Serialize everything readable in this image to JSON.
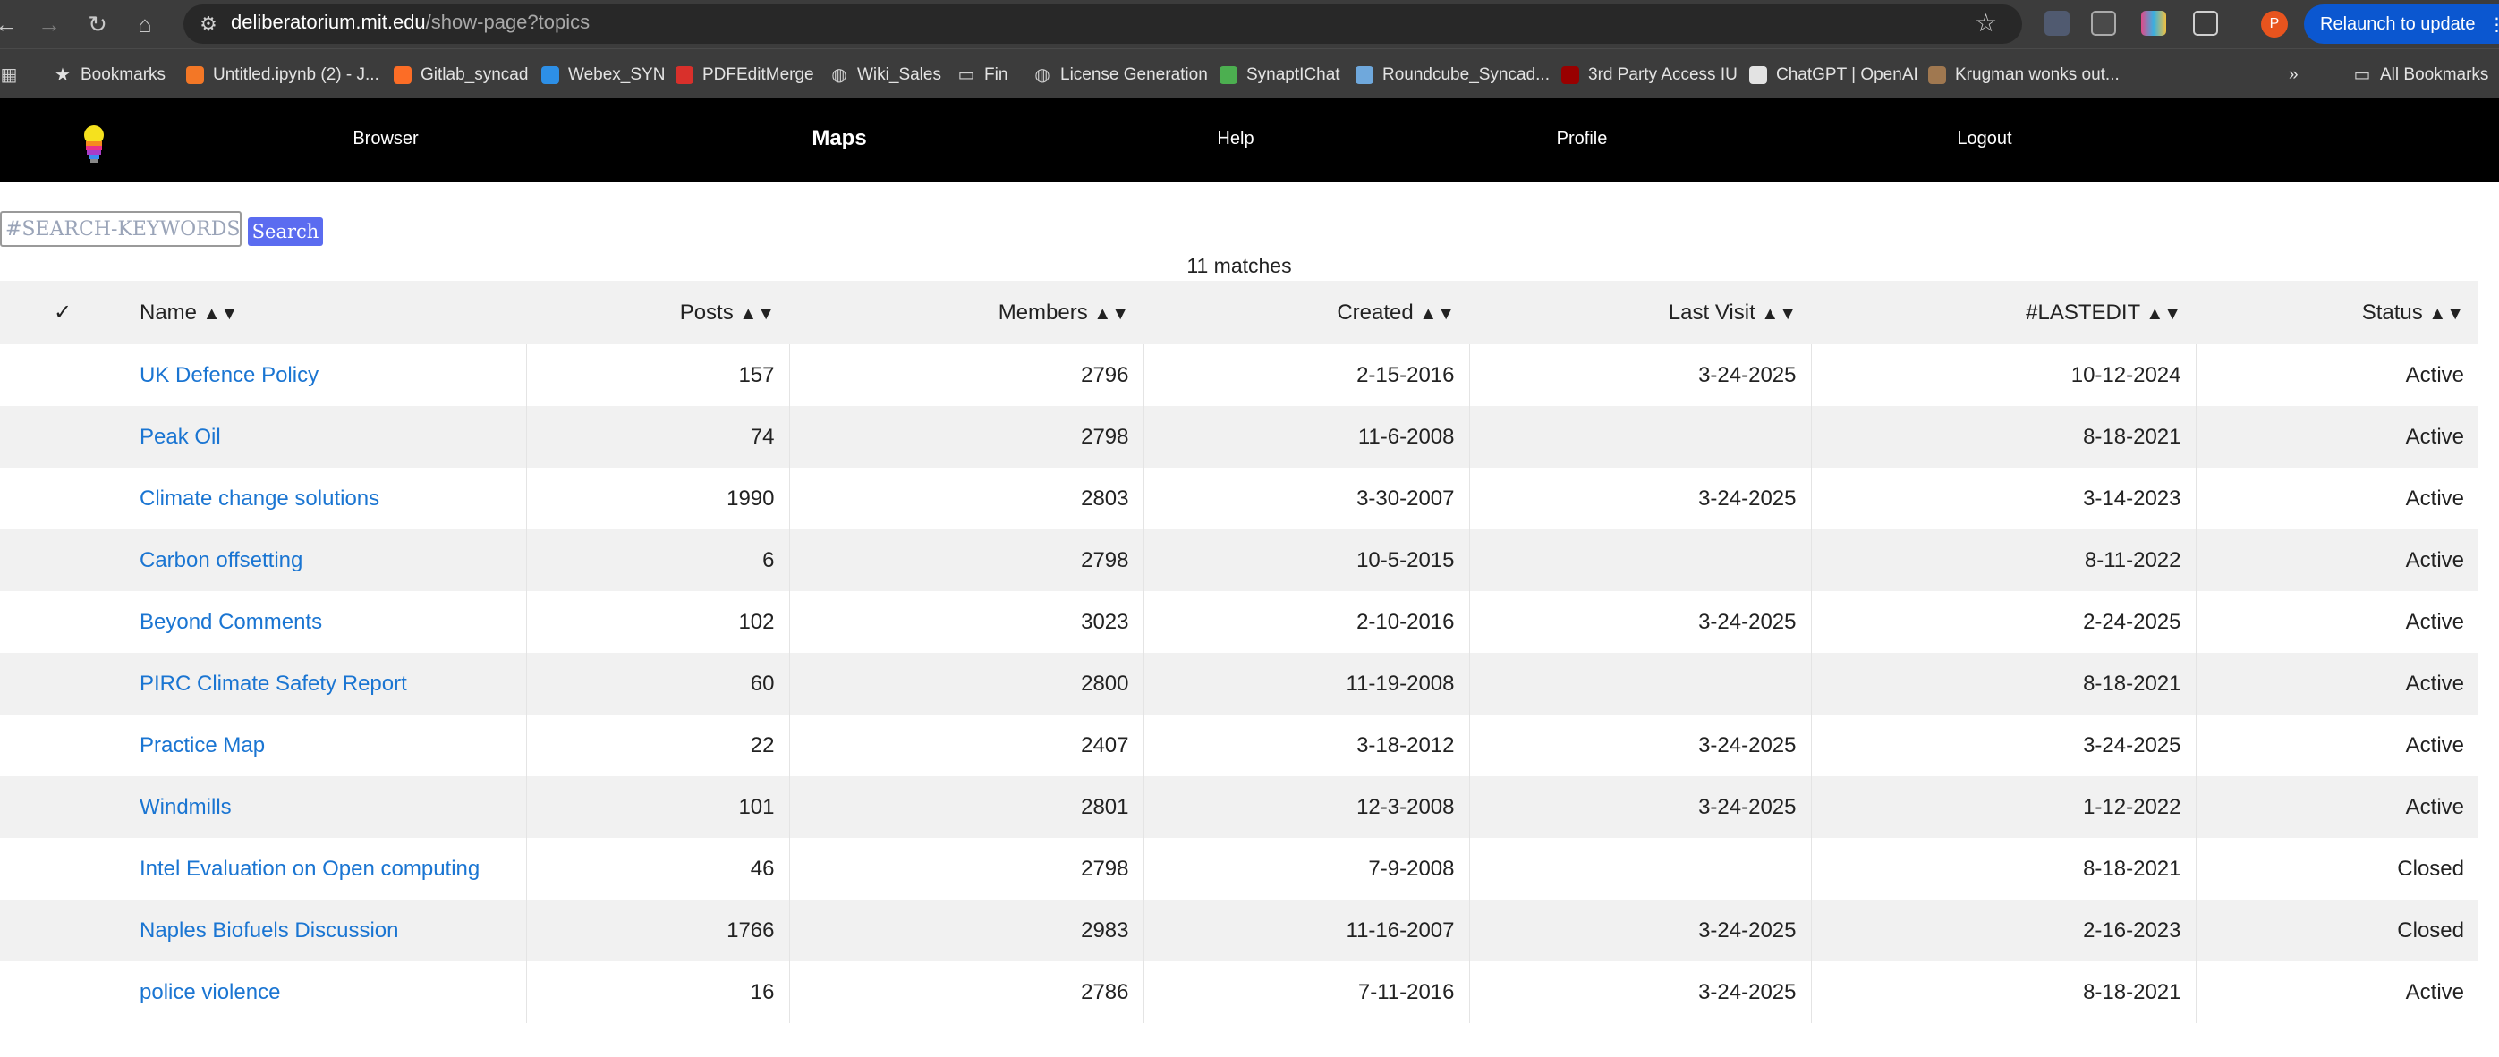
{
  "browser": {
    "url_host": "deliberatorium.mit.edu",
    "url_path": "/show-page?topics",
    "relaunch_label": "Relaunch to update",
    "profile_initial": "P",
    "bookmarks": [
      {
        "label": "Bookmarks",
        "icon": "star-icon",
        "color": "#e3e3e3"
      },
      {
        "label": "Untitled.ipynb (2) - J...",
        "icon": "jupyter-icon",
        "color": "#f37726"
      },
      {
        "label": "Gitlab_syncad",
        "icon": "gitlab-icon",
        "color": "#fc6d26"
      },
      {
        "label": "Webex_SYN",
        "icon": "webex-icon",
        "color": "#2d8fe6"
      },
      {
        "label": "PDFEditMerge",
        "icon": "pdf-icon",
        "color": "#d9302b"
      },
      {
        "label": "Wiki_Sales",
        "icon": "globe-icon",
        "color": "#cfcfcf"
      },
      {
        "label": "Fin",
        "icon": "folder-icon",
        "color": "#cfcfcf"
      },
      {
        "label": "License Generation",
        "icon": "globe-icon",
        "color": "#cfcfcf"
      },
      {
        "label": "SynaptIChat",
        "icon": "chat-icon",
        "color": "#4caf50"
      },
      {
        "label": "Roundcube_Syncad...",
        "icon": "roundcube-icon",
        "color": "#6fa8dc"
      },
      {
        "label": "3rd Party Access IU",
        "icon": "iu-icon",
        "color": "#990000"
      },
      {
        "label": "ChatGPT | OpenAI",
        "icon": "openai-icon",
        "color": "#e3e3e3"
      },
      {
        "label": "Krugman wonks out...",
        "icon": "image-icon",
        "color": "#a07850"
      }
    ],
    "all_bookmarks_label": "All Bookmarks"
  },
  "nav": {
    "items": [
      "Browser",
      "Maps",
      "Help",
      "Profile",
      "Logout"
    ],
    "active": "Maps"
  },
  "search": {
    "placeholder": "#SEARCH-KEYWORDS",
    "button_label": "Search"
  },
  "matches_label": "11 matches",
  "table": {
    "check_header": "✓",
    "sort_arrows": "▲▼",
    "headers": [
      "Name",
      "Posts",
      "Members",
      "Created",
      "Last Visit",
      "#LASTEDIT",
      "Status"
    ],
    "rows": [
      {
        "name": "UK Defence Policy",
        "posts": "157",
        "members": "2796",
        "created": "2-15-2016",
        "last_visit": "3-24-2025",
        "last_edit": "10-12-2024",
        "status": "Active"
      },
      {
        "name": "Peak Oil",
        "posts": "74",
        "members": "2798",
        "created": "11-6-2008",
        "last_visit": "",
        "last_edit": "8-18-2021",
        "status": "Active"
      },
      {
        "name": "Climate change solutions",
        "posts": "1990",
        "members": "2803",
        "created": "3-30-2007",
        "last_visit": "3-24-2025",
        "last_edit": "3-14-2023",
        "status": "Active"
      },
      {
        "name": "Carbon offsetting",
        "posts": "6",
        "members": "2798",
        "created": "10-5-2015",
        "last_visit": "",
        "last_edit": "8-11-2022",
        "status": "Active"
      },
      {
        "name": "Beyond Comments",
        "posts": "102",
        "members": "3023",
        "created": "2-10-2016",
        "last_visit": "3-24-2025",
        "last_edit": "2-24-2025",
        "status": "Active"
      },
      {
        "name": "PIRC Climate Safety Report",
        "posts": "60",
        "members": "2800",
        "created": "11-19-2008",
        "last_visit": "",
        "last_edit": "8-18-2021",
        "status": "Active"
      },
      {
        "name": "Practice Map",
        "posts": "22",
        "members": "2407",
        "created": "3-18-2012",
        "last_visit": "3-24-2025",
        "last_edit": "3-24-2025",
        "status": "Active"
      },
      {
        "name": "Windmills",
        "posts": "101",
        "members": "2801",
        "created": "12-3-2008",
        "last_visit": "3-24-2025",
        "last_edit": "1-12-2022",
        "status": "Active"
      },
      {
        "name": "Intel Evaluation on Open computing",
        "posts": "46",
        "members": "2798",
        "created": "7-9-2008",
        "last_visit": "",
        "last_edit": "8-18-2021",
        "status": "Closed"
      },
      {
        "name": "Naples Biofuels Discussion",
        "posts": "1766",
        "members": "2983",
        "created": "11-16-2007",
        "last_visit": "3-24-2025",
        "last_edit": "2-16-2023",
        "status": "Closed"
      },
      {
        "name": "police violence",
        "posts": "16",
        "members": "2786",
        "created": "7-11-2016",
        "last_visit": "3-24-2025",
        "last_edit": "8-18-2021",
        "status": "Active"
      }
    ]
  },
  "colors": {
    "link": "#1a75d2",
    "search_button": "#5b6cf0",
    "nav_bg": "#000000",
    "row_stripe": "#f1f1f1"
  }
}
